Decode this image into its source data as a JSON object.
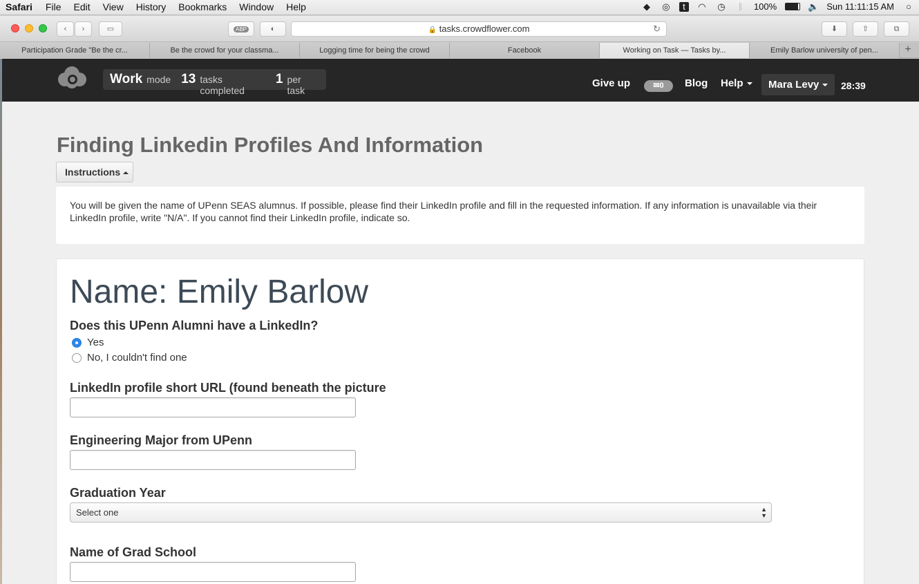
{
  "menubar": {
    "app": "Safari",
    "items": [
      "File",
      "Edit",
      "View",
      "History",
      "Bookmarks",
      "Window",
      "Help"
    ],
    "battery": "100%",
    "clock": "Sun 11:11:15 AM"
  },
  "toolbar": {
    "url": "tasks.crowdflower.com",
    "abp": "ABP"
  },
  "tabs": [
    "Participation Grade \"Be the cr...",
    "Be the crowd for your classma...",
    "Logging time for being the crowd",
    "Facebook",
    "Working on Task — Tasks by...",
    "Emily Barlow university of pen..."
  ],
  "header": {
    "work": "Work",
    "mode": "mode",
    "tasks_count": "13",
    "tasks_label": "tasks completed",
    "per_count": "1",
    "per_label": "per task",
    "give_up": "Give up",
    "mail_count": "0",
    "blog": "Blog",
    "help": "Help",
    "user": "Mara Levy",
    "timer": "28:39"
  },
  "page": {
    "title": "Finding Linkedin Profiles And Information",
    "instructions_button": "Instructions",
    "instructions_text": "You will be given the name of UPenn SEAS alumnus. If possible, please find their LinkedIn profile and fill in the requested information. If any information is unavailable via their LinkedIn profile, write \"N/A\". If you cannot find their LinkedIn profile, indicate so.",
    "name": "Name: Emily Barlow",
    "q_linkedin": "Does this UPenn Alumni have a LinkedIn?",
    "opt_yes": "Yes",
    "opt_no": "No, I couldn't find one",
    "q_url": "LinkedIn profile short URL (found beneath the picture",
    "q_major": "Engineering Major from UPenn",
    "q_grad_year": "Graduation Year",
    "grad_year_selected": "Select one",
    "q_grad_school": "Name of Grad School"
  }
}
